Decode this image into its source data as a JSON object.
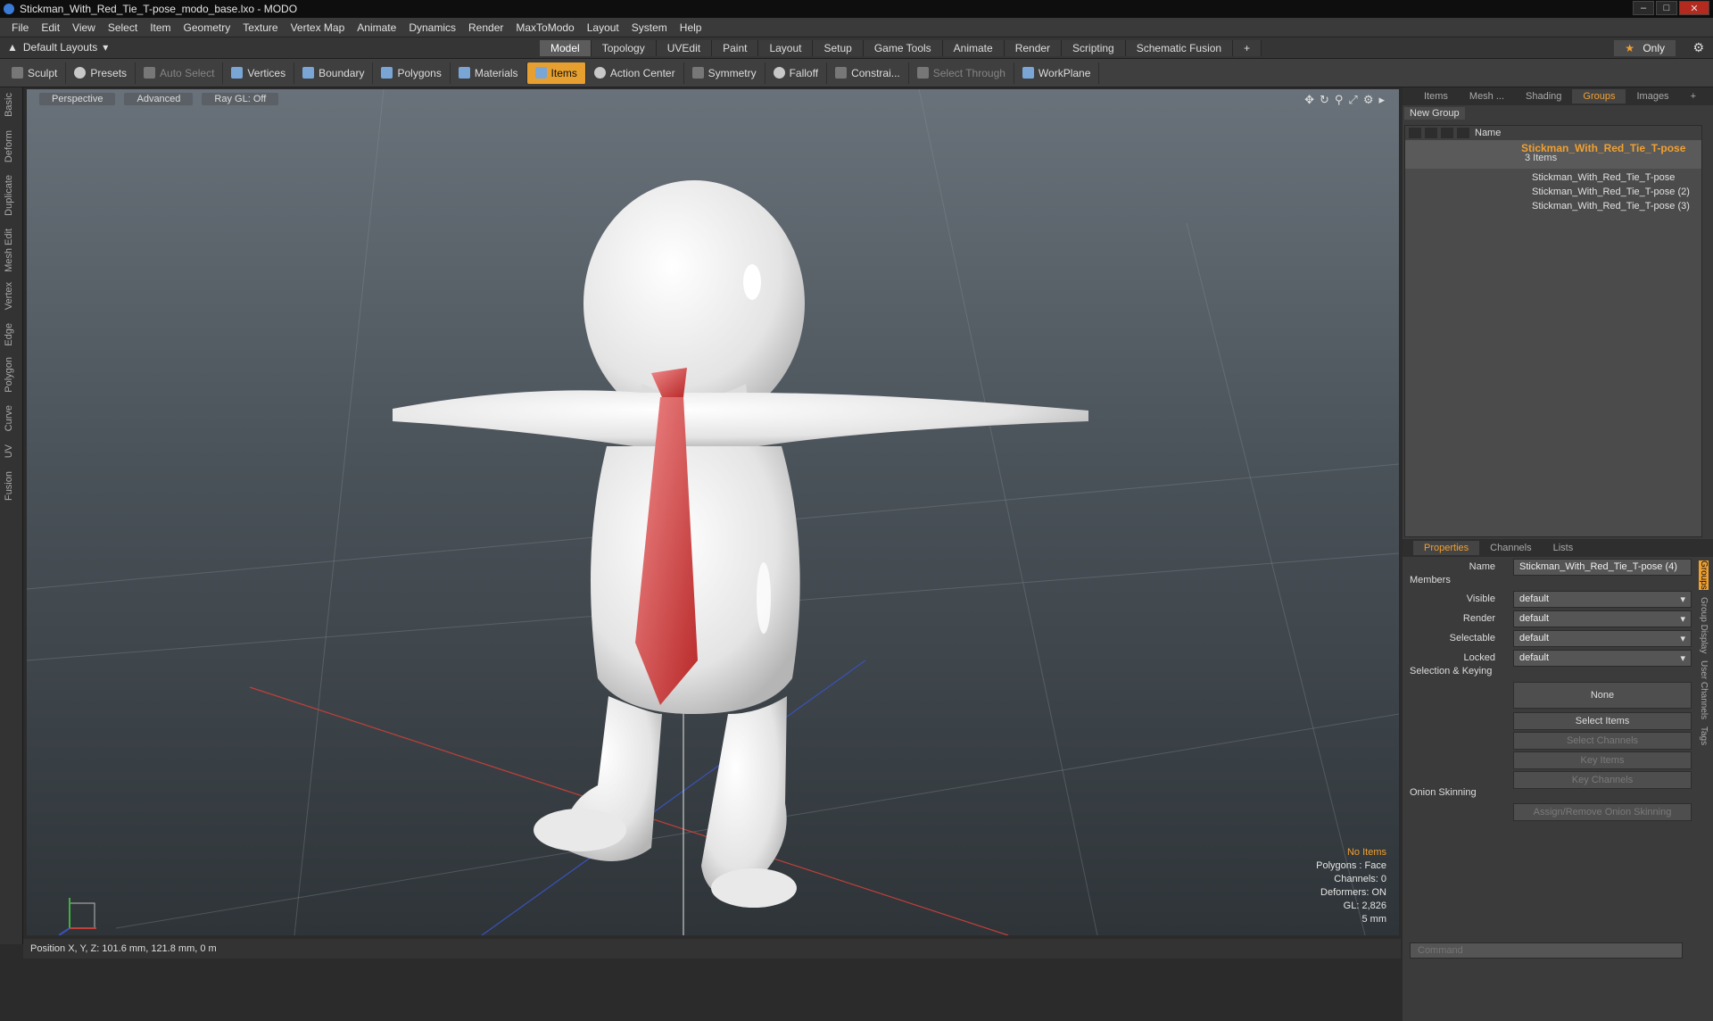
{
  "window": {
    "title": "Stickman_With_Red_Tie_T-pose_modo_base.lxo - MODO"
  },
  "menubar": [
    "File",
    "Edit",
    "View",
    "Select",
    "Item",
    "Geometry",
    "Texture",
    "Vertex Map",
    "Animate",
    "Dynamics",
    "Render",
    "MaxToModo",
    "Layout",
    "System",
    "Help"
  ],
  "layout": {
    "dropdown": "Default Layouts",
    "mode_tabs": [
      "Model",
      "Topology",
      "UVEdit",
      "Paint",
      "Layout",
      "Setup",
      "Game Tools",
      "Animate",
      "Render",
      "Scripting",
      "Schematic Fusion"
    ],
    "active_mode": "Model",
    "only_label": "Only"
  },
  "toolbar": {
    "sculpt": "Sculpt",
    "presets": "Presets",
    "auto_select": "Auto Select",
    "vertices": "Vertices",
    "boundary": "Boundary",
    "polygons": "Polygons",
    "materials": "Materials",
    "items": "Items",
    "action_center": "Action Center",
    "symmetry": "Symmetry",
    "falloff": "Falloff",
    "constraints": "Constrai...",
    "select_through": "Select Through",
    "workplane": "WorkPlane"
  },
  "left_tabs": [
    "Basic",
    "Deform",
    "Duplicate",
    "Mesh Edit",
    "Vertex",
    "Edge",
    "Polygon",
    "Curve",
    "UV",
    "Fusion"
  ],
  "viewport": {
    "view": "Perspective",
    "shading": "Advanced",
    "raygl": "Ray GL: Off",
    "info": {
      "items": "No Items",
      "polygons": "Polygons : Face",
      "channels": "Channels: 0",
      "deformers": "Deformers: ON",
      "gl": "GL: 2,826",
      "scale": "5 mm"
    }
  },
  "status": {
    "position": "Position X, Y, Z:  101.6 mm, 121.8 mm, 0 m"
  },
  "groups_panel": {
    "tabs": [
      "Items",
      "Mesh ...",
      "Shading",
      "Groups",
      "Images"
    ],
    "active_tab": "Groups",
    "new_group": "New Group",
    "name_col": "Name",
    "group_name": "Stickman_With_Red_Tie_T-pose",
    "group_count": "3 Items",
    "children": [
      "Stickman_With_Red_Tie_T-pose",
      "Stickman_With_Red_Tie_T-pose (2)",
      "Stickman_With_Red_Tie_T-pose (3)"
    ]
  },
  "properties": {
    "tabs": [
      "Properties",
      "Channels",
      "Lists"
    ],
    "name_label": "Name",
    "name_value": "Stickman_With_Red_Tie_T-pose (4)",
    "members_section": "Members",
    "visible_label": "Visible",
    "visible_value": "default",
    "render_label": "Render",
    "render_value": "default",
    "selectable_label": "Selectable",
    "selectable_value": "default",
    "locked_label": "Locked",
    "locked_value": "default",
    "selection_section": "Selection & Keying",
    "none_btn": "None",
    "select_items": "Select Items",
    "select_channels": "Select Channels",
    "key_items": "Key Items",
    "key_channels": "Key Channels",
    "onion_section": "Onion Skinning",
    "onion_btn": "Assign/Remove Onion Skinning",
    "side_tabs": [
      "Groups",
      "Group Display",
      "User Channels",
      "Tags"
    ]
  },
  "command": {
    "placeholder": "Command"
  }
}
